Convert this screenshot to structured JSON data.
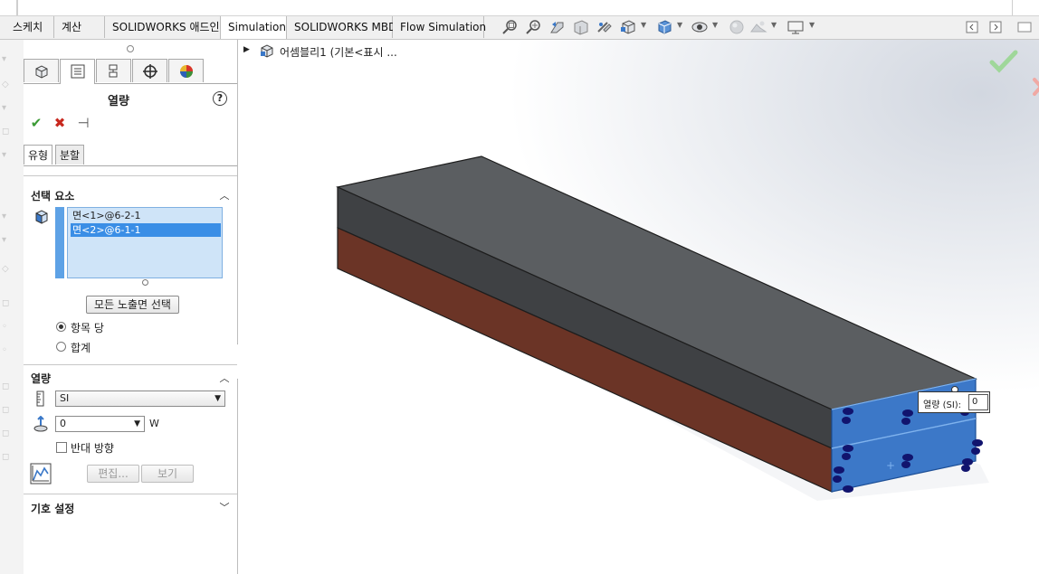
{
  "ribbon_tabs": [
    "스케치",
    "계산",
    "SOLIDWORKS 애드인",
    "Simulation",
    "SOLIDWORKS MBD",
    "Flow Simulation"
  ],
  "active_tab": "Simulation",
  "property_manager": {
    "title": "열량",
    "help_glyph": "?",
    "sub_tabs": [
      "유형",
      "분할"
    ],
    "selection_section": {
      "title": "선택 요소",
      "items": [
        "면<1>@6-2-1",
        "면<2>@6-1-1"
      ],
      "selected_index": 1,
      "select_all_button": "모든 노출면 선택",
      "radio_options": [
        {
          "label": "항목 당",
          "checked": true
        },
        {
          "label": "합계",
          "checked": false
        }
      ]
    },
    "heat_section": {
      "title": "열량",
      "unit_system": "SI",
      "value": "0",
      "unit": "W",
      "reverse_direction_label": "반대 방향",
      "reverse_direction_checked": false,
      "edit_button": "편집...",
      "view_button": "보기"
    },
    "symbol_section": {
      "title": "기호 설정"
    }
  },
  "viewport": {
    "tree_label": "어셈블리1  (기본<표시 ...",
    "callout": {
      "label": "열량 (SI):",
      "value": "0"
    }
  },
  "colors": {
    "top_face": "#5b5e61",
    "dark_side": "#3f4144",
    "brown_side": "#6b3426",
    "highlight_face": "#3c78c8",
    "accept_green": "#46b83c",
    "reject_red": "#c8281e",
    "selection_blue": "#3a8ee6"
  }
}
